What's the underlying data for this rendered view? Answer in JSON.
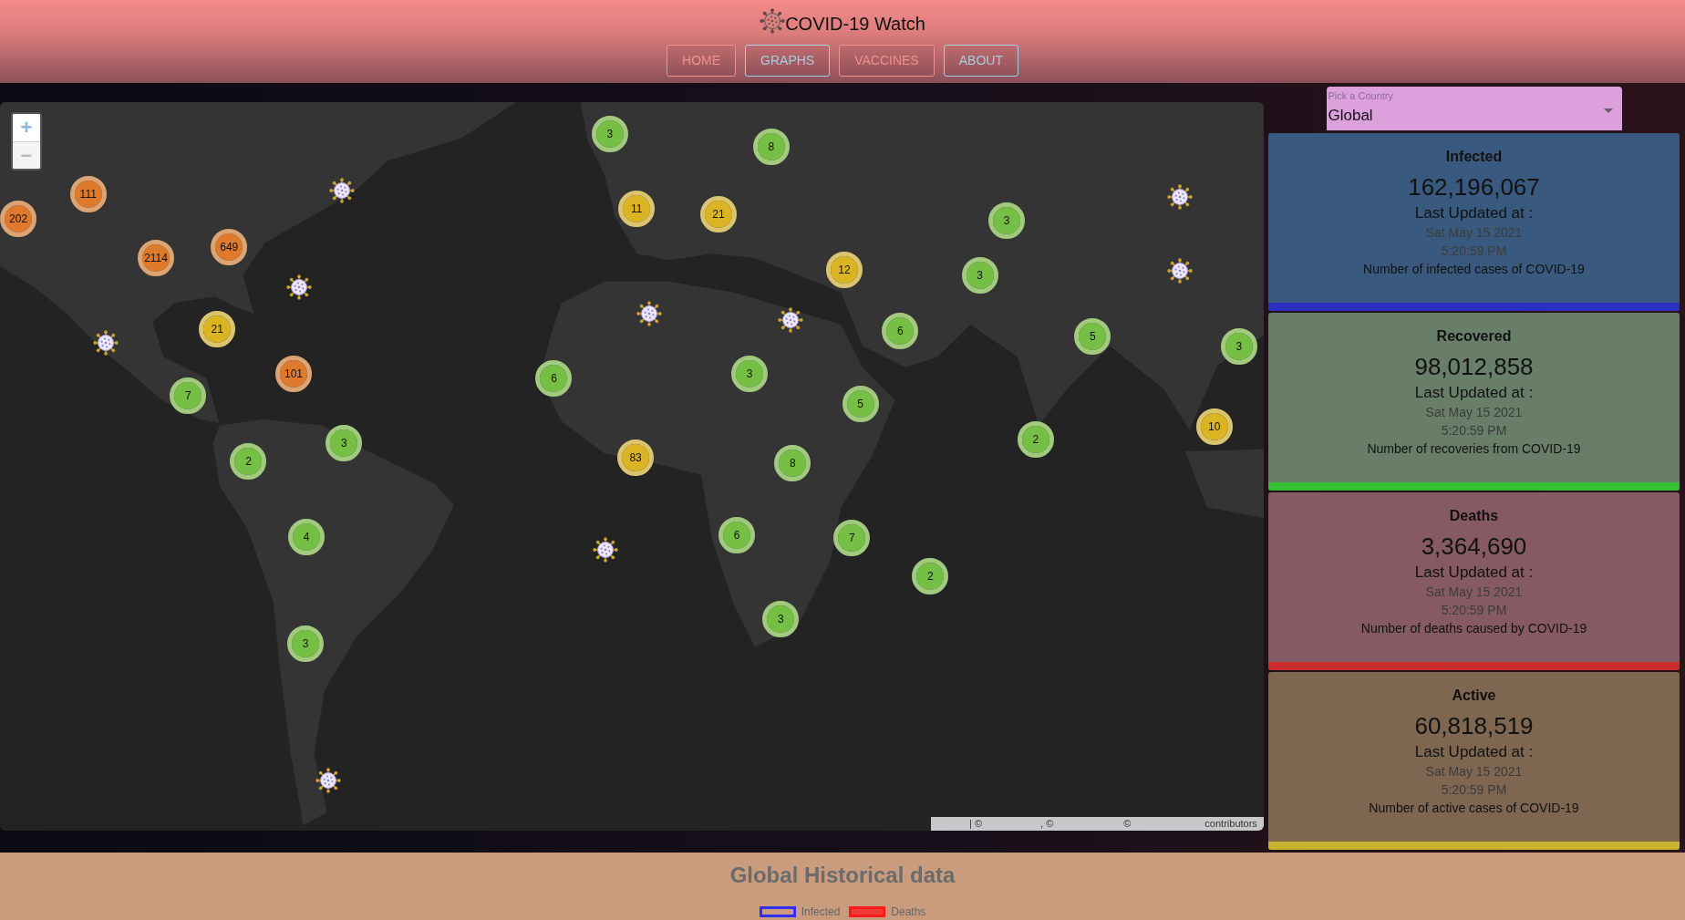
{
  "header": {
    "title": "COVID-19 Watch",
    "nav": [
      {
        "label": "HOME",
        "color": "#f2908e"
      },
      {
        "label": "GRAPHS",
        "color": "#a6cde2"
      },
      {
        "label": "VACCINES",
        "color": "#f2908e"
      },
      {
        "label": "ABOUT",
        "color": "#a6cde2"
      }
    ]
  },
  "map": {
    "zoom_controls": [
      {
        "label": "+",
        "disabled": false
      },
      {
        "label": "−",
        "disabled": true
      }
    ],
    "clusters": [
      {
        "count": "3",
        "color": "#74bf44"
      },
      {
        "count": "8",
        "color": "#74bf44"
      },
      {
        "count": "111",
        "color": "#df7a2c"
      },
      {
        "count": "11",
        "color": "#dbb424"
      },
      {
        "count": "202",
        "color": "#df7a2c"
      },
      {
        "count": "21",
        "color": "#dbb424"
      },
      {
        "count": "3",
        "color": "#74bf44"
      },
      {
        "count": "649",
        "color": "#df7a2c"
      },
      {
        "count": "2114",
        "color": "#df7a2c"
      },
      {
        "count": "12",
        "color": "#dbb424"
      },
      {
        "count": "3",
        "color": "#74bf44"
      },
      {
        "count": "21",
        "color": "#dbb424"
      },
      {
        "count": "6",
        "color": "#74bf44"
      },
      {
        "count": "5",
        "color": "#74bf44"
      },
      {
        "count": "3",
        "color": "#74bf44"
      },
      {
        "count": "101",
        "color": "#df7a2c"
      },
      {
        "count": "6",
        "color": "#74bf44"
      },
      {
        "count": "3",
        "color": "#74bf44"
      },
      {
        "count": "7",
        "color": "#74bf44"
      },
      {
        "count": "5",
        "color": "#74bf44"
      },
      {
        "count": "10",
        "color": "#dbb424"
      },
      {
        "count": "3",
        "color": "#74bf44"
      },
      {
        "count": "2",
        "color": "#74bf44"
      },
      {
        "count": "2",
        "color": "#74bf44"
      },
      {
        "count": "83",
        "color": "#dbb424"
      },
      {
        "count": "8",
        "color": "#74bf44"
      },
      {
        "count": "4",
        "color": "#74bf44"
      },
      {
        "count": "6",
        "color": "#74bf44"
      },
      {
        "count": "7",
        "color": "#74bf44"
      },
      {
        "count": "2",
        "color": "#74bf44"
      },
      {
        "count": "3",
        "color": "#74bf44"
      },
      {
        "count": "3",
        "color": "#74bf44"
      }
    ],
    "attribution": [
      "| ©",
      ", ©",
      "©",
      "contributors"
    ]
  },
  "country_select": {
    "label": "Pick a Country",
    "value": "Global"
  },
  "stat_cards": [
    {
      "kind": "infected",
      "title": "Infected",
      "value": "162,196,067",
      "updated_label": "Last Updated at :",
      "date": "Sat May 15 2021",
      "time": "5:20:59 PM",
      "description": "Number of infected cases of COVID-19"
    },
    {
      "kind": "recovered",
      "title": "Recovered",
      "value": "98,012,858",
      "updated_label": "Last Updated at :",
      "date": "Sat May 15 2021",
      "time": "5:20:59 PM",
      "description": "Number of recoveries from COVID-19"
    },
    {
      "kind": "deaths",
      "title": "Deaths",
      "value": "3,364,690",
      "updated_label": "Last Updated at :",
      "date": "Sat May 15 2021",
      "time": "5:20:59 PM",
      "description": "Number of deaths caused by COVID-19"
    },
    {
      "kind": "active",
      "title": "Active",
      "value": "60,818,519",
      "updated_label": "Last Updated at :",
      "date": "Sat May 15 2021",
      "time": "5:20:59 PM",
      "description": "Number of active cases of COVID-19"
    }
  ],
  "historical": {
    "title": "Global Historical data",
    "legend": [
      {
        "label": "Infected",
        "color": "#2f2ff5",
        "filled": false
      },
      {
        "label": "Deaths",
        "color": "#ff1a1a",
        "filled": true
      }
    ]
  }
}
